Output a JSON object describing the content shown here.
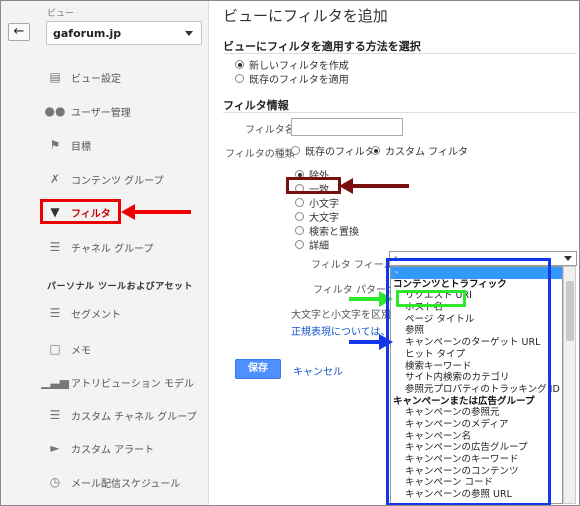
{
  "sidebar": {
    "view_label": "ビュー",
    "view_value": "gaforum.jp",
    "items": [
      {
        "label": "ビュー設定",
        "icon": "document-icon"
      },
      {
        "label": "ユーザー管理",
        "icon": "users-icon"
      },
      {
        "label": "目標",
        "icon": "flag-icon"
      },
      {
        "label": "コンテンツ グループ",
        "icon": "tool-icon"
      },
      {
        "label": "フィルタ",
        "icon": "filter-icon"
      },
      {
        "label": "チャネル グループ",
        "icon": "channel-icon"
      }
    ],
    "section_title": "パーソナル ツールおよびアセット",
    "personal_items": [
      {
        "label": "セグメント",
        "icon": "segment-icon"
      },
      {
        "label": "メモ",
        "icon": "comment-icon"
      },
      {
        "label": "アトリビューション モデル",
        "icon": "bar-chart-icon"
      },
      {
        "label": "カスタム チャネル グループ",
        "icon": "channel-icon"
      },
      {
        "label": "カスタム アラート",
        "icon": "megaphone-icon"
      },
      {
        "label": "メール配信スケジュール",
        "icon": "clock-icon"
      }
    ]
  },
  "main": {
    "title": "ビューにフィルタを追加",
    "apply_method_heading": "ビューにフィルタを適用する方法を選択",
    "apply_options": [
      "新しいフィルタを作成",
      "既存のフィルタを適用"
    ],
    "filter_info_heading": "フィルタ情報",
    "filter_name_label": "フィルタ名",
    "filter_name_value": "",
    "filter_type_label": "フィルタの種類",
    "filter_type_options": [
      "既存のフィルタ",
      "カスタム フィルタ"
    ],
    "custom_options": [
      "除外",
      "一致",
      "小文字",
      "大文字",
      "検索と置換",
      "詳細"
    ],
    "filter_field_label": "フィルタ フィールド",
    "filter_field_value": "-",
    "filter_pattern_label": "フィルタ パターン",
    "case_label": "大文字と小文字を区別",
    "regex_link": "正規表現については、こ",
    "save_label": "保存",
    "cancel_label": "キャンセル"
  },
  "dropdown": {
    "options": [
      {
        "label": "-",
        "kind": "sel"
      },
      {
        "label": "コンテンツとトラフィック",
        "kind": "grp"
      },
      {
        "label": "リクエスト URI",
        "kind": "sub"
      },
      {
        "label": "ホスト名",
        "kind": "sub"
      },
      {
        "label": "ページ タイトル",
        "kind": "sub"
      },
      {
        "label": "参照",
        "kind": "sub"
      },
      {
        "label": "キャンペーンのターゲット URL",
        "kind": "sub"
      },
      {
        "label": "ヒット タイプ",
        "kind": "sub"
      },
      {
        "label": "検索キーワード",
        "kind": "sub"
      },
      {
        "label": "サイト内検索のカテゴリ",
        "kind": "sub"
      },
      {
        "label": "参照元プロパティのトラッキング ID",
        "kind": "sub"
      },
      {
        "label": "キャンペーンまたは広告グループ",
        "kind": "grp"
      },
      {
        "label": "キャンペーンの参照元",
        "kind": "sub"
      },
      {
        "label": "キャンペーンのメディア",
        "kind": "sub"
      },
      {
        "label": "キャンペーン名",
        "kind": "sub"
      },
      {
        "label": "キャンペーンの広告グループ",
        "kind": "sub"
      },
      {
        "label": "キャンペーンのキーワード",
        "kind": "sub"
      },
      {
        "label": "キャンペーンのコンテンツ",
        "kind": "sub"
      },
      {
        "label": "キャンペーン コード",
        "kind": "sub"
      },
      {
        "label": "キャンペーンの参照 URL",
        "kind": "sub"
      }
    ]
  },
  "colors": {
    "annotation_red": "#e00000",
    "annotation_dark_red": "#7a0f0f",
    "annotation_green": "#2ee82e",
    "annotation_blue": "#1236e8",
    "save_button": "#4d90fe",
    "link": "#1155cc"
  }
}
